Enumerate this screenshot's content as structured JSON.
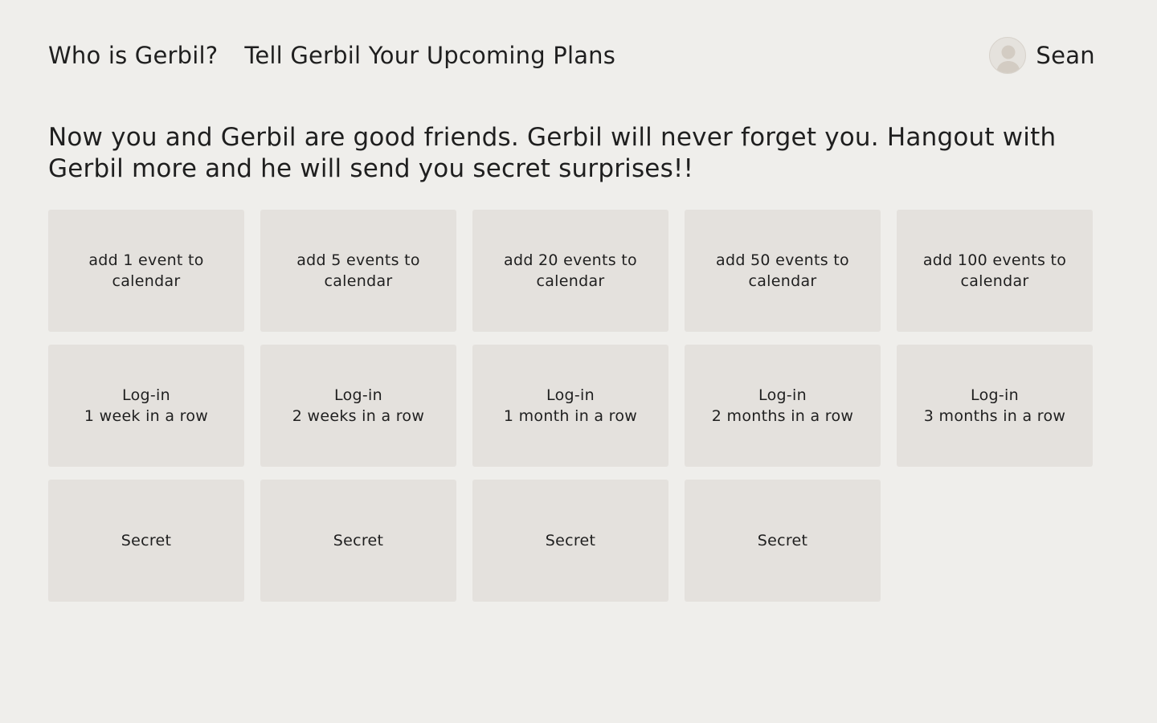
{
  "nav": {
    "who": "Who is Gerbil?",
    "plans": "Tell Gerbil Your Upcoming Plans"
  },
  "user": {
    "name": "Sean"
  },
  "headline": "Now you and Gerbil are good friends. Gerbil will never forget you. Hangout with Gerbil more and he will send you secret surprises!!",
  "achievements": [
    {
      "line1": "add 1 event to calendar",
      "line2": ""
    },
    {
      "line1": "add 5 events to calendar",
      "line2": ""
    },
    {
      "line1": "add 20 events to calendar",
      "line2": ""
    },
    {
      "line1": "add 50 events to calendar",
      "line2": ""
    },
    {
      "line1": "add 100 events to calendar",
      "line2": ""
    },
    {
      "line1": "Log-in",
      "line2": "1 week in a row"
    },
    {
      "line1": "Log-in",
      "line2": "2 weeks in a row"
    },
    {
      "line1": "Log-in",
      "line2": "1 month in a row"
    },
    {
      "line1": "Log-in",
      "line2": "2 months in a row"
    },
    {
      "line1": "Log-in",
      "line2": "3 months in a row"
    },
    {
      "line1": "Secret",
      "line2": ""
    },
    {
      "line1": "Secret",
      "line2": ""
    },
    {
      "line1": "Secret",
      "line2": ""
    },
    {
      "line1": "Secret",
      "line2": ""
    }
  ],
  "colors": {
    "background": "#efeeeb",
    "card": "#e4e1dd",
    "text": "#1f1f1f"
  },
  "icons": {
    "avatar": "user-avatar-icon"
  }
}
